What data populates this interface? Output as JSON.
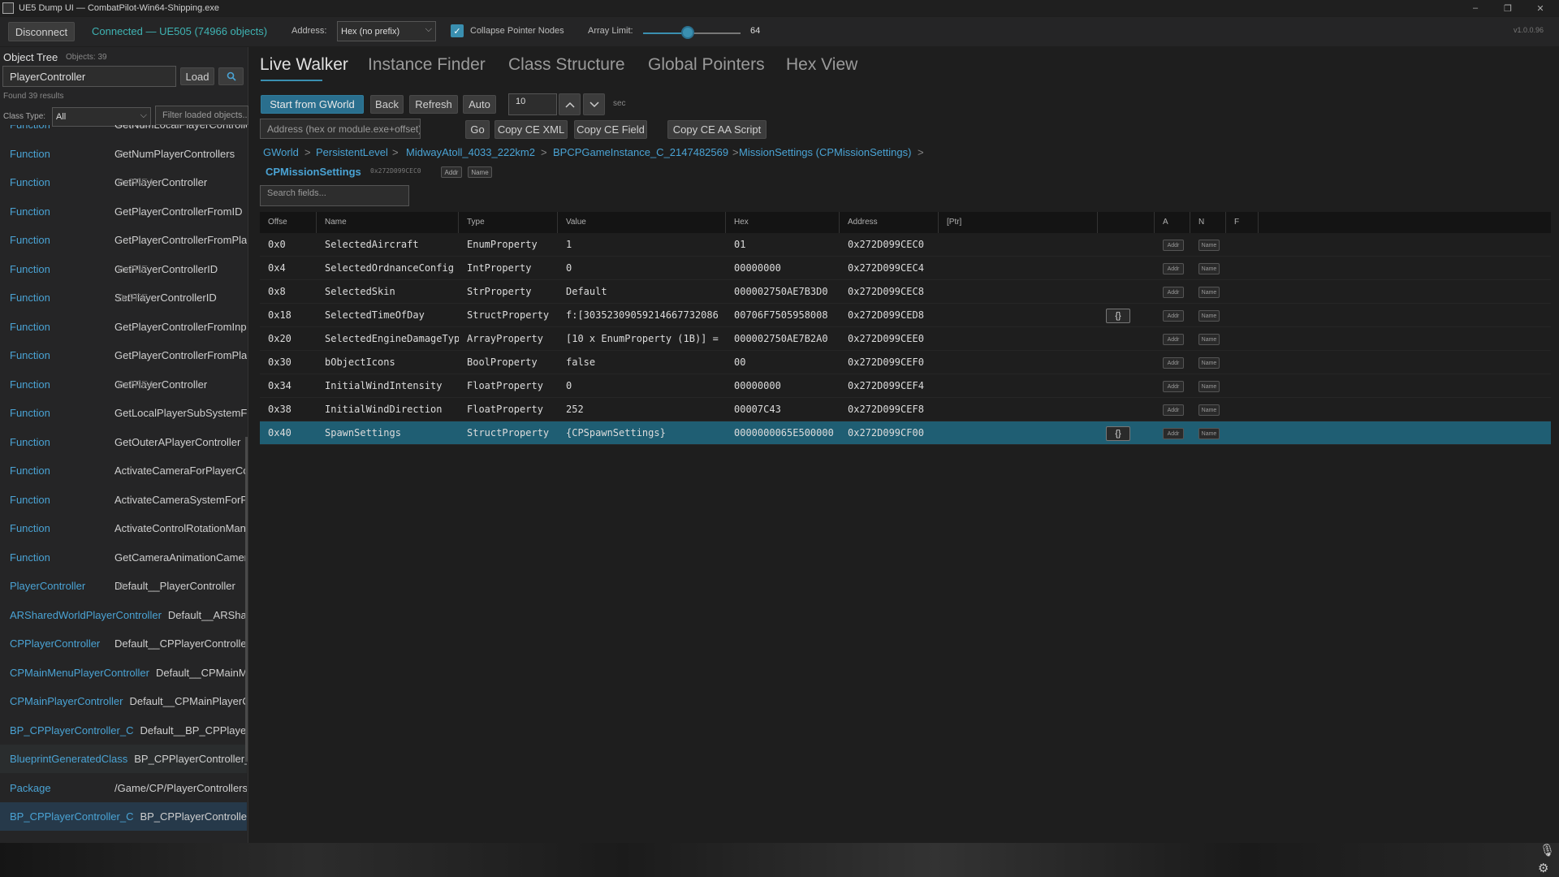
{
  "window": {
    "title": "UE5 Dump UI — CombatPilot-Win64-Shipping.exe",
    "controls": [
      "–",
      "❐",
      "✕"
    ]
  },
  "toolbar": {
    "disconnect_label": "Disconnect",
    "status": "Connected — UE505 (74966 objects)",
    "address_label": "Address:",
    "address_format": "Hex (no prefix)",
    "collapse_label": "Collapse Pointer Nodes",
    "collapse_checked": true,
    "array_limit_label": "Array Limit:",
    "array_limit_value": "64",
    "version": "v1.0.0.96",
    "status_color": "#3fb3b3",
    "accent_color": "#3a8fb0"
  },
  "left": {
    "header": "Object Tree",
    "objects_count": "Objects: 39",
    "search_value": "PlayerController",
    "load_label": "Load",
    "search_icon": "search-icon",
    "found_text": "Found 39 results",
    "class_type_label": "Class Type:",
    "class_type_value": "All",
    "filter_placeholder": "Filter loaded objects...",
    "rows": [
      {
        "cls": "Function",
        "name": "GetNumLocalPlayerControllers",
        "addr": ""
      },
      {
        "cls": "Function",
        "name": "GetNumPlayerControllers",
        "addr": "0"
      },
      {
        "cls": "Function",
        "name": "GetPlayerController",
        "addr": "0x7FF4"
      },
      {
        "cls": "Function",
        "name": "GetPlayerControllerFromID",
        "addr": ""
      },
      {
        "cls": "Function",
        "name": "GetPlayerControllerFromPlatformUser",
        "addr": ""
      },
      {
        "cls": "Function",
        "name": "GetPlayerControllerID",
        "addr": "0x7FF"
      },
      {
        "cls": "Function",
        "name": "SetPlayerControllerID",
        "addr": "0x7FF"
      },
      {
        "cls": "Function",
        "name": "GetPlayerControllerFromInputDevice",
        "addr": ""
      },
      {
        "cls": "Function",
        "name": "GetPlayerControllerFromPlatformUser",
        "addr": ""
      },
      {
        "cls": "Function",
        "name": "GetPlayerController",
        "addr": "0x7FF4"
      },
      {
        "cls": "Function",
        "name": "GetLocalPlayerSubSystemFromPlayerController",
        "addr": ""
      },
      {
        "cls": "Function",
        "name": "GetOuterAPlayerController",
        "addr": ""
      },
      {
        "cls": "Function",
        "name": "ActivateCameraForPlayerController",
        "addr": ""
      },
      {
        "cls": "Function",
        "name": "ActivateCameraSystemForPlayerController",
        "addr": ""
      },
      {
        "cls": "Function",
        "name": "ActivateControlRotationManager",
        "addr": ""
      },
      {
        "cls": "Function",
        "name": "GetCameraAnimationCameraManager",
        "addr": ""
      },
      {
        "cls": "PlayerController",
        "name": "Default__PlayerController",
        "addr": "0"
      },
      {
        "cls": "ARSharedWorldPlayerController",
        "name": "Default__ARSharedWorldPlayerController",
        "addr": ""
      },
      {
        "cls": "CPPlayerController",
        "name": "Default__CPPlayerController",
        "addr": ""
      },
      {
        "cls": "CPMainMenuPlayerController",
        "name": "Default__CPMainMenuPlayerController",
        "addr": ""
      },
      {
        "cls": "CPMainPlayerController",
        "name": "Default__CPMainPlayerController",
        "addr": ""
      },
      {
        "cls": "BP_CPPlayerController_C",
        "name": "Default__BP_CPPlayerController_C",
        "addr": ""
      },
      {
        "cls": "BlueprintGeneratedClass",
        "name": "BP_CPPlayerController_C",
        "addr": ""
      },
      {
        "cls": "Package",
        "name": "/Game/CP/PlayerControllers",
        "addr": ""
      },
      {
        "cls": "BP_CPPlayerController_C",
        "name": "BP_CPPlayerController_C",
        "addr": ""
      }
    ]
  },
  "tabs": [
    "Live Walker",
    "Instance Finder",
    "Class Structure",
    "Global Pointers",
    "Hex View"
  ],
  "walker": {
    "start_label": "Start from GWorld",
    "back_label": "Back",
    "refresh_label": "Refresh",
    "auto_label": "Auto",
    "interval_value": "10",
    "interval_unit": "sec",
    "address_placeholder": "Address (hex or module.exe+offset)",
    "go_label": "Go",
    "copy_ce_xml": "Copy CE XML",
    "copy_ce_field": "Copy CE Field",
    "copy_ce_aa": "Copy CE AA Script",
    "breadcrumbs": [
      "GWorld",
      "PersistentLevel",
      "MidwayAtoll_4033_222km2",
      "BPCPGameInstance_C_2147482569",
      "MissionSettings (CPMissionSettings)"
    ],
    "crumb_sep": ">",
    "object_name": "CPMissionSettings",
    "object_addr": "0x272D099CEC0",
    "addr_btn": "Addr",
    "name_btn": "Name",
    "search_placeholder": "Search fields..."
  },
  "grid": {
    "headers": [
      "Offse",
      "Name",
      "Type",
      "Value",
      "Hex",
      "Address",
      "[Ptr]",
      "",
      "A",
      "N",
      "F"
    ],
    "rows": [
      {
        "offset": "0x0",
        "name": "SelectedAircraft",
        "type": "EnumProperty",
        "value": "1",
        "hex": "01",
        "address": "0x272D099CEC0",
        "brace": false
      },
      {
        "offset": "0x4",
        "name": "SelectedOrdnanceConfig",
        "type": "IntProperty",
        "value": "0",
        "hex": "00000000",
        "address": "0x272D099CEC4",
        "brace": false
      },
      {
        "offset": "0x8",
        "name": "SelectedSkin",
        "type": "StrProperty",
        "value": "Default",
        "hex": "000002750AE7B3D0",
        "address": "0x272D099CEC8",
        "brace": false
      },
      {
        "offset": "0x18",
        "name": "SelectedTimeOfDay",
        "type": "StructProperty",
        "value": "f:[30352309059214667732086",
        "hex": "00706F7505958008",
        "address": "0x272D099CED8",
        "brace": true
      },
      {
        "offset": "0x20",
        "name": "SelectedEngineDamageType",
        "type": "ArrayProperty",
        "value": "[10 x EnumProperty (1B)] =",
        "hex": "000002750AE7B2A0",
        "address": "0x272D099CEE0",
        "brace": false
      },
      {
        "offset": "0x30",
        "name": "bObjectIcons",
        "type": "BoolProperty",
        "value": "false",
        "hex": "00",
        "address": "0x272D099CEF0",
        "brace": false
      },
      {
        "offset": "0x34",
        "name": "InitialWindIntensity",
        "type": "FloatProperty",
        "value": "0",
        "hex": "00000000",
        "address": "0x272D099CEF4",
        "brace": false
      },
      {
        "offset": "0x38",
        "name": "InitialWindDirection",
        "type": "FloatProperty",
        "value": "252",
        "hex": "00007C43",
        "address": "0x272D099CEF8",
        "brace": false
      },
      {
        "offset": "0x40",
        "name": "SpawnSettings",
        "type": "StructProperty",
        "value": "{CPSpawnSettings}",
        "hex": "0000000065E500000",
        "address": "0x272D099CF00",
        "brace": true
      }
    ],
    "brace_label": "{}",
    "addr_btn": "Addr",
    "name_btn": "Name"
  },
  "bottom": {
    "mic_icon": "microphone-icon",
    "settings_icon": "gear-icon"
  }
}
